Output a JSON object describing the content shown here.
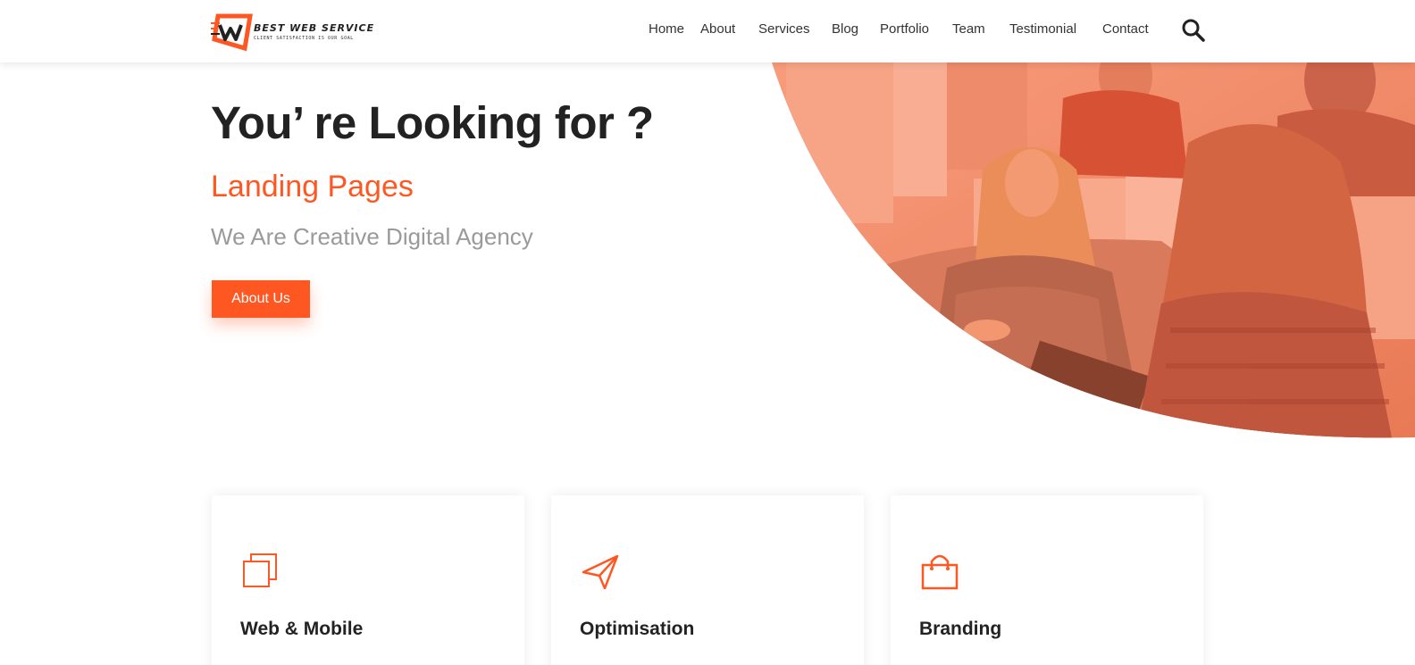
{
  "brand": {
    "name": "BEST WEB SERVICE",
    "tagline": "CLIENT SATISFACTION IS OUR GOAL",
    "accent": "#ff5722"
  },
  "nav": {
    "items": [
      {
        "label": "Home"
      },
      {
        "label": "About"
      },
      {
        "label": "Services"
      },
      {
        "label": "Blog"
      },
      {
        "label": "Portfolio"
      },
      {
        "label": "Team"
      },
      {
        "label": "Testimonial"
      },
      {
        "label": "Contact"
      }
    ],
    "search_icon": "search-icon"
  },
  "hero": {
    "title": "You’ re Looking for ?",
    "rotating_text": "Landing Pages",
    "tagline": "We Are Creative Digital Agency",
    "button_label": "About Us"
  },
  "services": [
    {
      "title": "Web & Mobile",
      "icon": "copy-icon"
    },
    {
      "title": "Optimisation",
      "icon": "paper-plane-icon"
    },
    {
      "title": "Branding",
      "icon": "shopping-bag-icon"
    }
  ]
}
